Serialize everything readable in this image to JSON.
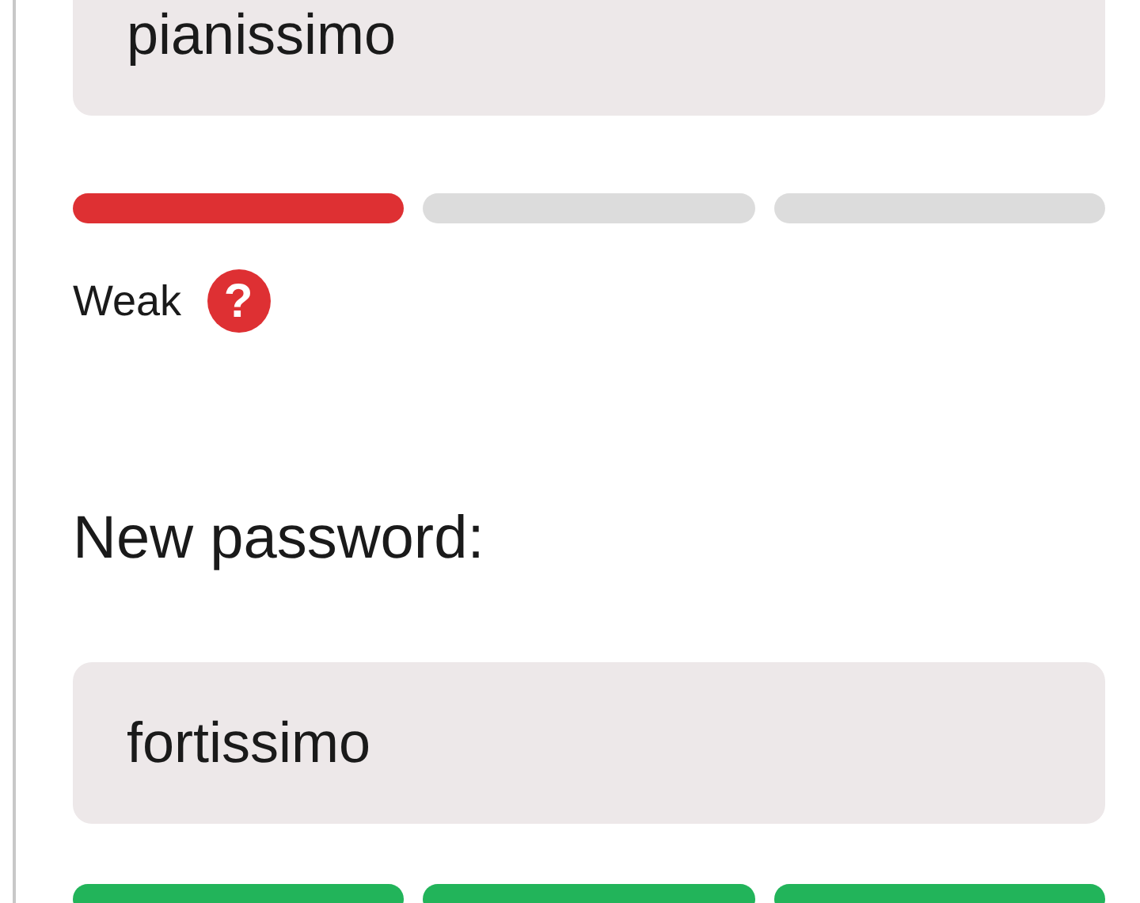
{
  "fields": [
    {
      "value": "pianissimo",
      "meter": {
        "color": "#de3033",
        "segments": [
          {
            "on": true
          },
          {
            "on": false
          },
          {
            "on": false
          }
        ]
      },
      "strength": "Weak",
      "help": "?"
    },
    {
      "label": "New password:",
      "value": "fortissimo",
      "meter": {
        "color": "#22b45a",
        "segments": [
          {
            "on": true
          },
          {
            "on": true
          },
          {
            "on": true
          }
        ]
      }
    }
  ]
}
